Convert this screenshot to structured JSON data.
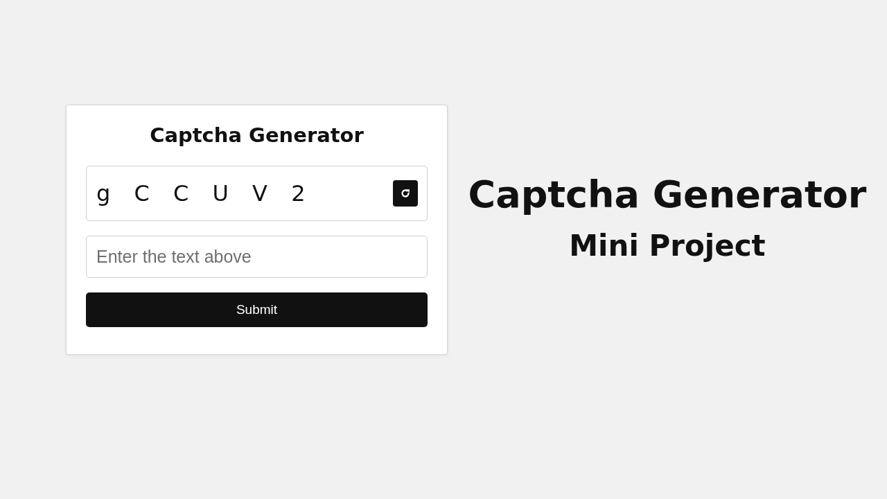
{
  "card": {
    "title": "Captcha Generator",
    "captcha": "g C C U V 2",
    "answer": {
      "placeholder": "Enter the text above"
    },
    "submit": "Submit"
  },
  "heading": {
    "title": "Captcha Generator",
    "subtitle": "Mini Project"
  }
}
